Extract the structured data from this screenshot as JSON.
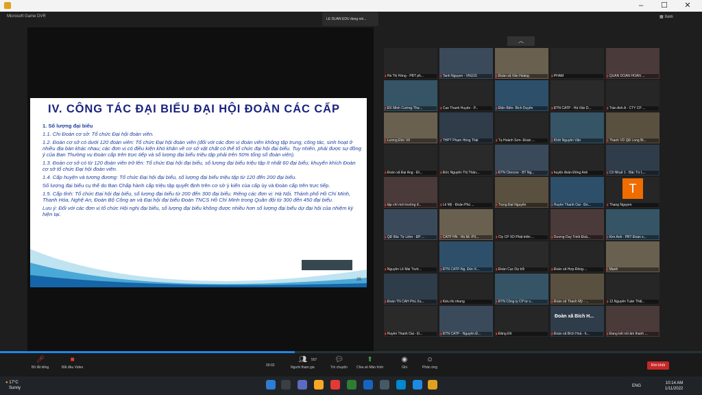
{
  "window": {
    "minimize": "–",
    "maximize": "☐",
    "close": "✕"
  },
  "gamebar_label": "Microsoft Game DVR",
  "toast": "LE DUAN EDU đang nói...",
  "view_label": "Xem",
  "slide": {
    "title": "IV. CÔNG TÁC ĐẠI BIỂU ĐẠI HỘI ĐOÀN CÁC CẤP",
    "page": "26",
    "heading": "1. Số lượng đại biểu",
    "p1": "1.1. Chi Đoàn cơ sở: Tổ chức Đại hội đoàn viên.",
    "p2": "1.2. Đoàn cơ sở có dưới 120 đoàn viên: Tổ chức Đại hội đoàn viên (đối với các đơn vị đoàn viên không tập trung, công tác, sinh hoạt ở nhiều địa bàn khác nhau; các đơn vị có điều kiện khó khăn về cơ sở vật chất có thể tổ chức đại hội đại biểu. Tuy nhiên, phải được sự đồng ý của Ban Thường vụ Đoàn cấp trên trực tiếp và số lượng đại biểu triệu tập phải trên 50% tổng số đoàn viên).",
    "p3": "1.3. Đoàn cơ sở có từ 120 đoàn viên trở lên: Tổ chức Đại hội đại biểu, số lượng đại biểu triệu tập ít nhất 60 đại biểu; khuyến khích Đoàn cơ sở tổ chức Đại hội đoàn viên.",
    "p4": "1.4. Cấp huyện và tương đương: Tổ chức Đại hội đại biểu, số lượng đại biểu triệu tập từ 120 đến 200 đại biểu.",
    "p5": "Số lượng đại biểu cụ thể do Ban Chấp hành cấp triệu tập quyết định trên cơ sở ý kiến của cấp ủy và Đoàn cấp trên trực tiếp.",
    "p6": "1.5. Cấp tỉnh: Tổ chức Đại hội đại biểu, số lượng đại biểu từ 200 đến 300 đại biểu. Riêng các đơn vị: Hà Nội, Thành phố Hồ Chí Minh, Thanh Hóa, Nghệ An, Đoàn Bộ Công an và Đại hội đại biểu Đoàn TNCS Hồ Chí Minh trong Quân đội từ 300 đến 450 đại biểu.",
    "p7": "Lưu ý: Đối với các đơn vị tổ chức Hội nghị đại biểu, số lượng đại biểu không được nhiều hơn số lượng đại biểu dự đại hội của nhiệm kỳ hiện tại."
  },
  "participants": [
    "Hà Thị Hồng - PBT ph...",
    "Tanh Nguyen - VNU15",
    "Đoàn xã Văn Hoàng",
    "PHAM",
    "QUAN DOAN HOAN ...",
    "ĐX Minh Cường-Thư...",
    "Cao Thanh Huyền - P...",
    "Điện Biên- Bích Duyên",
    "ĐTN CATP - Hà Văn D...",
    "Trần Anh A - CTY CP ...",
    "Lương Đức Võ",
    "THPT Phạm Hồng Thái",
    "Tạ Hoành Sơn- Đoàn ...",
    "Khởi Nguyễn Văn",
    "Thanh VD QĐ Long Bi...",
    "Đoàn xã Đại Áng - Đi...",
    "Đức Nguyễn Thị Thàn...",
    "ĐTN Clencoe - BT Ng...",
    "huyện đoàn Đông Anh",
    "Cổ Nhuế 1 - Bắc Từ L...",
    "tập chí mới trường đ...",
    "Lê Mỹ - Đoàn Phú ...",
    "Trọng Đạt Nguyễn",
    "Huyền Thanh Oai - Đo...",
    "Thang Nguyen",
    "QĐ Bắc Từ Liêm - ĐP ...",
    "CATP HN - Hà Mi -PX...",
    "Cty CP XD Phát triển ...",
    "Dương Duy Trinh Đoà...",
    "Kim Anh - PBT Đoàn x...",
    "Nguyễn Lê Mai Trườ...",
    "ĐTN CATP-Ng. Đức K...",
    "Đoàn Cục Dự trữ",
    "Đoàn xã Hợp Đồng-...",
    "Mạnh",
    "Đoàn TN CAH Phú Xu...",
    "Kiều thị nhung",
    "ĐTN Công ty CP tư v...",
    "Đoàn xã Thanh Mỹ - ...",
    "12.Nguyễn Tuấn Thiệ...",
    "Huyền Thanh Oai - Đ...",
    "ĐTN CATP - Nguyễn Đ...",
    "Đăng Đỗ",
    "Đoàn xã Bích Hoà - h...",
    "Đang kết nối âm thanh ..."
  ],
  "tile_center_text": {
    "big_letter": "T",
    "bich_hoa": "Đoàn xã Bích H..."
  },
  "toolbar": {
    "mute": "Bỏ tắt tiếng",
    "video": "Bắt đầu Video",
    "time": "00:02",
    "participants": "Người tham gia",
    "participants_count": "507",
    "chat": "Trò chuyện",
    "share": "Chia sẻ Màn hình",
    "record": "Ghi",
    "reactions": "Phản ứng",
    "leave": "Rời khỏi"
  },
  "progress_fraction": 0.42,
  "taskbar": {
    "temp": "17°C",
    "weather": "Sunny",
    "lang": "ENG",
    "time": "10:14 AM",
    "date": "1/11/2022"
  },
  "colors": {
    "accent": "#1e88e5",
    "leave": "#c62828",
    "slide_title": "#1a237e",
    "slide_text": "#1d3f9e"
  }
}
